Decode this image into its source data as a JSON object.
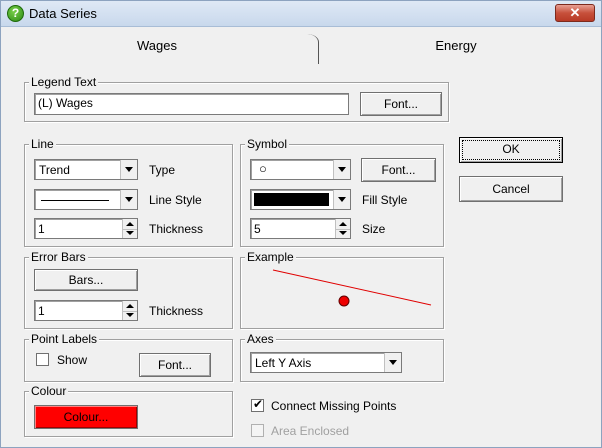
{
  "window": {
    "title": "Data Series",
    "close_glyph": "✕",
    "app_icon_glyph": "?"
  },
  "tabs": [
    {
      "label": "Wages",
      "selected": true
    },
    {
      "label": "Energy",
      "selected": false
    }
  ],
  "legend": {
    "group_label": "Legend Text",
    "value": "(L) Wages",
    "font_button": "Font..."
  },
  "line": {
    "group_label": "Line",
    "type_value": "Trend",
    "type_label": "Type",
    "style_label": "Line Style",
    "thickness_value": "1",
    "thickness_label": "Thickness"
  },
  "symbol": {
    "group_label": "Symbol",
    "symbol_value": "○",
    "font_button": "Font...",
    "fill_label": "Fill Style",
    "size_value": "5",
    "size_label": "Size"
  },
  "error_bars": {
    "group_label": "Error Bars",
    "bars_button": "Bars...",
    "thickness_value": "1",
    "thickness_label": "Thickness"
  },
  "example": {
    "group_label": "Example"
  },
  "point_labels": {
    "group_label": "Point Labels",
    "show_label": "Show",
    "show_checked": false,
    "font_button": "Font..."
  },
  "axes": {
    "group_label": "Axes",
    "value": "Left Y Axis"
  },
  "colour": {
    "group_label": "Colour",
    "button": "Colour...",
    "swatch": "#ff0000"
  },
  "options": {
    "connect_label": "Connect Missing Points",
    "connect_checked": true,
    "area_label": "Area Enclosed",
    "area_checked": false
  },
  "buttons": {
    "ok": "OK",
    "cancel": "Cancel"
  },
  "colors": {
    "example_line": "#e00000",
    "example_point": "#e00000"
  }
}
